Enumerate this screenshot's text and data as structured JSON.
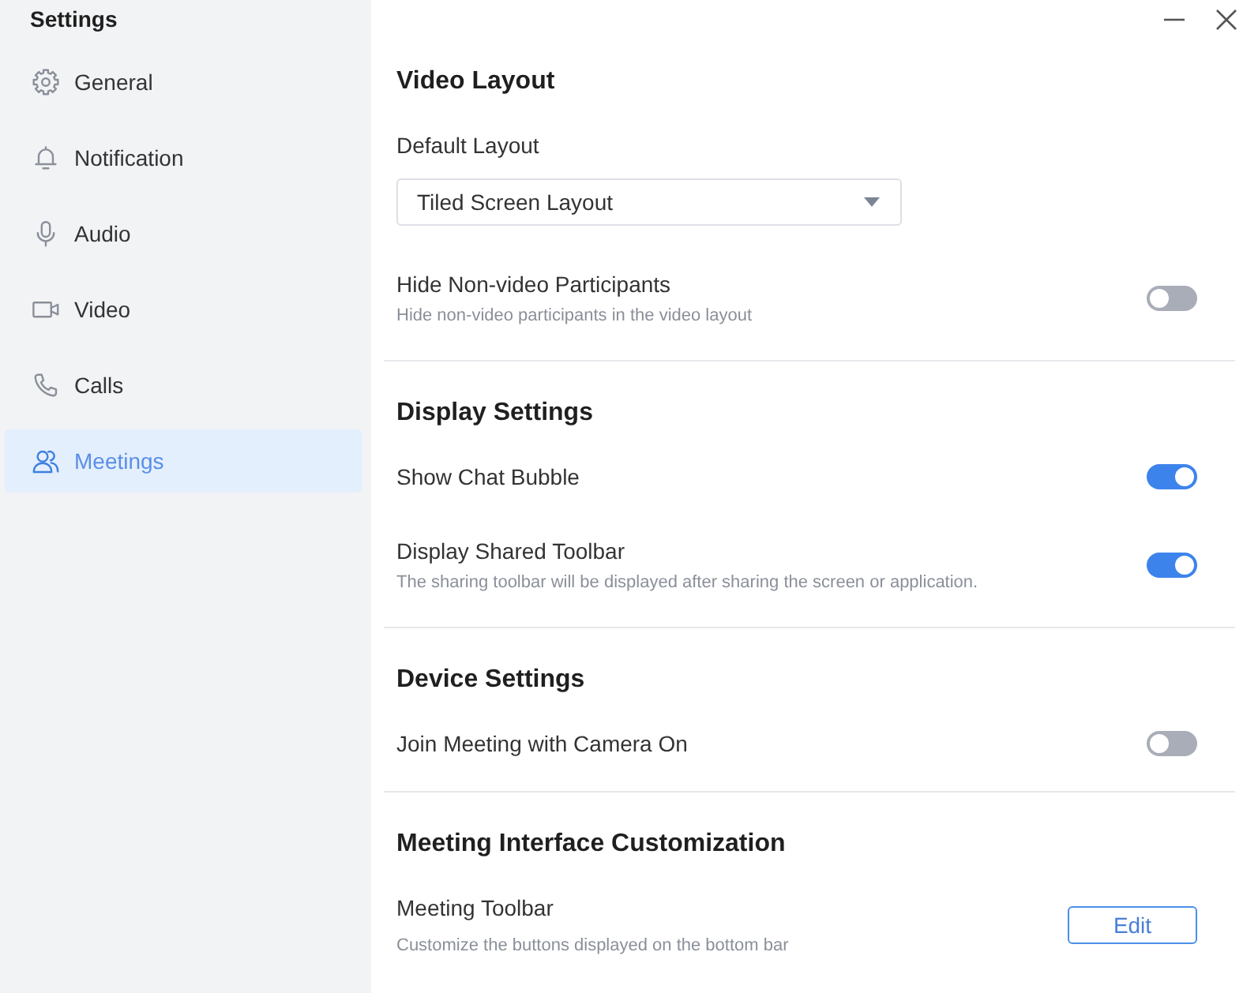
{
  "window": {
    "title": "Settings"
  },
  "sidebar": {
    "items": [
      {
        "label": "General",
        "selected": false
      },
      {
        "label": "Notification",
        "selected": false
      },
      {
        "label": "Audio",
        "selected": false
      },
      {
        "label": "Video",
        "selected": false
      },
      {
        "label": "Calls",
        "selected": false
      },
      {
        "label": "Meetings",
        "selected": true
      }
    ]
  },
  "sections": [
    {
      "title": "Video Layout",
      "settings": [
        {
          "kind": "dropdown",
          "label": "Default Layout",
          "value": "Tiled Screen Layout"
        },
        {
          "kind": "toggle",
          "label": "Hide Non-video Participants",
          "description": "Hide non-video participants in the video layout",
          "on": false
        }
      ]
    },
    {
      "title": "Display Settings",
      "settings": [
        {
          "kind": "toggle",
          "label": "Show Chat Bubble",
          "on": true
        },
        {
          "kind": "toggle",
          "label": "Display Shared Toolbar",
          "description": "The sharing toolbar will be displayed after sharing the screen or application.",
          "on": true
        }
      ]
    },
    {
      "title": "Device Settings",
      "settings": [
        {
          "kind": "toggle",
          "label": "Join Meeting with Camera On",
          "on": false
        }
      ]
    },
    {
      "title": "Meeting Interface Customization",
      "settings": [
        {
          "kind": "button",
          "label": "Meeting Toolbar",
          "description": "Customize the buttons displayed on the bottom bar",
          "button": "Edit"
        }
      ]
    }
  ]
}
